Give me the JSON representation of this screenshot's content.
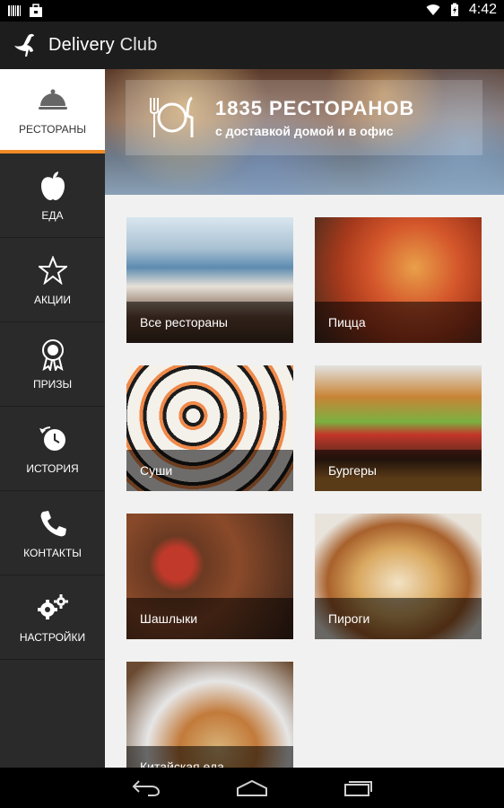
{
  "status_bar": {
    "time": "4:42"
  },
  "app_bar": {
    "title_main": "Delivery",
    "title_sub": "Club"
  },
  "sidebar": {
    "items": [
      {
        "label": "РЕСТОРАНЫ",
        "icon": "cloche-icon",
        "active": true
      },
      {
        "label": "ЕДА",
        "icon": "apple-icon"
      },
      {
        "label": "АКЦИИ",
        "icon": "star-icon"
      },
      {
        "label": "ПРИЗЫ",
        "icon": "award-ribbon-icon"
      },
      {
        "label": "ИСТОРИЯ",
        "icon": "history-clock-icon"
      },
      {
        "label": "КОНТАКТЫ",
        "icon": "phone-icon"
      },
      {
        "label": "НАСТРОЙКИ",
        "icon": "gears-icon"
      }
    ]
  },
  "hero": {
    "count": "1835 РЕСТОРАНОВ",
    "subtitle": "с доставкой домой и в офис"
  },
  "categories": [
    {
      "label": "Все рестораны"
    },
    {
      "label": "Пицца"
    },
    {
      "label": "Суши"
    },
    {
      "label": "Бургеры"
    },
    {
      "label": "Шашлыки"
    },
    {
      "label": "Пироги"
    },
    {
      "label": "Китайская еда"
    }
  ],
  "colors": {
    "accent": "#f08a24",
    "sidebar": "#2a2a2a",
    "appbar": "#1d1d1d"
  }
}
